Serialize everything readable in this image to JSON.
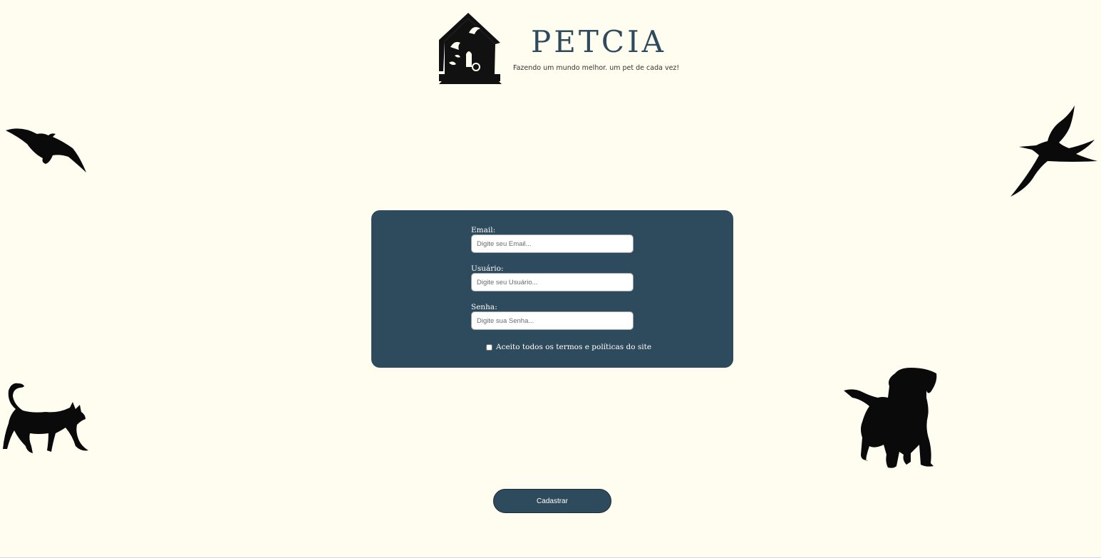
{
  "header": {
    "title": "PETCIA",
    "tagline": "Fazendo um mundo melhor. um pet de cada vez!",
    "logo_icon": "pet-shelter-logo-icon"
  },
  "decorations": {
    "top_left": "gull-silhouette-icon",
    "top_right": "swallow-silhouette-icon",
    "bottom_left": "cat-silhouette-icon",
    "bottom_right": "puppy-silhouette-icon"
  },
  "form": {
    "email": {
      "label": "Email:",
      "placeholder": "Digite seu Email..."
    },
    "username": {
      "label": "Usuário:",
      "placeholder": "Digite seu Usuário..."
    },
    "password": {
      "label": "Senha:",
      "placeholder": "Digite sua Senha..."
    },
    "terms_label": "Aceito todos os termos e políticas do site",
    "terms_checked": false
  },
  "submit_label": "Cadastrar",
  "colors": {
    "background": "#fffdf0",
    "primary": "#2e4a5d",
    "silhouette": "#0a0a0a"
  }
}
